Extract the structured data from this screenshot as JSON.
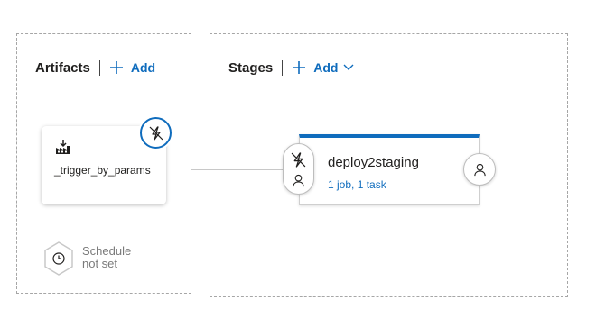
{
  "artifacts": {
    "title": "Artifacts",
    "add_label": "Add",
    "items": [
      {
        "name": "_trigger_by_params",
        "icon": "build-artifact-icon",
        "trigger_icon": "continuous-deployment-trigger-icon"
      }
    ],
    "schedule": {
      "line1": "Schedule",
      "line2": "not set",
      "icon": "clock-icon"
    }
  },
  "stages": {
    "title": "Stages",
    "add_label": "Add",
    "items": [
      {
        "name": "deploy2staging",
        "summary": "1 job, 1 task",
        "pre_icons": [
          "trigger-icon",
          "user-icon"
        ],
        "post_icon": "user-icon"
      }
    ]
  },
  "colors": {
    "accent": "#0f6cbd",
    "border": "#a6a6a6"
  }
}
